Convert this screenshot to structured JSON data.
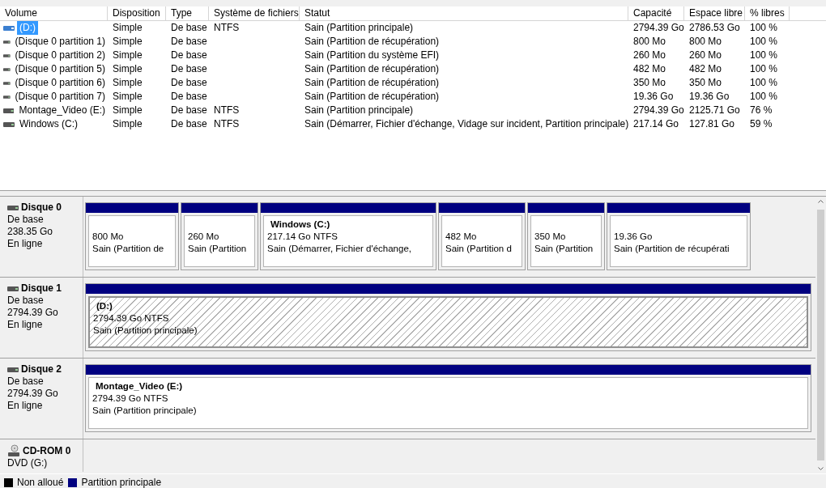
{
  "volume_list": {
    "columns": [
      "Volume",
      "Disposition",
      "Type",
      "Système de fichiers",
      "Statut",
      "Capacité",
      "Espace libre",
      "% libres"
    ],
    "rows": [
      {
        "selected": true,
        "cells": [
          "(D:)",
          "Simple",
          "De base",
          "NTFS",
          "Sain (Partition principale)",
          "2794.39 Go",
          "2786.53 Go",
          "100 %"
        ]
      },
      {
        "selected": false,
        "cells": [
          "(Disque 0 partition 1)",
          "Simple",
          "De base",
          "",
          "Sain (Partition de récupération)",
          "800 Mo",
          "800 Mo",
          "100 %"
        ]
      },
      {
        "selected": false,
        "cells": [
          "(Disque 0 partition 2)",
          "Simple",
          "De base",
          "",
          "Sain (Partition du système EFI)",
          "260 Mo",
          "260 Mo",
          "100 %"
        ]
      },
      {
        "selected": false,
        "cells": [
          "(Disque 0 partition 5)",
          "Simple",
          "De base",
          "",
          "Sain (Partition de récupération)",
          "482 Mo",
          "482 Mo",
          "100 %"
        ]
      },
      {
        "selected": false,
        "cells": [
          "(Disque 0 partition 6)",
          "Simple",
          "De base",
          "",
          "Sain (Partition de récupération)",
          "350 Mo",
          "350 Mo",
          "100 %"
        ]
      },
      {
        "selected": false,
        "cells": [
          "(Disque 0 partition 7)",
          "Simple",
          "De base",
          "",
          "Sain (Partition de récupération)",
          "19.36 Go",
          "19.36 Go",
          "100 %"
        ]
      },
      {
        "selected": false,
        "cells": [
          "Montage_Video (E:)",
          "Simple",
          "De base",
          "NTFS",
          "Sain (Partition principale)",
          "2794.39 Go",
          "2125.71 Go",
          "76 %"
        ]
      },
      {
        "selected": false,
        "cells": [
          "Windows (C:)",
          "Simple",
          "De base",
          "NTFS",
          "Sain (Démarrer, Fichier d'échange, Vidage sur incident, Partition principale)",
          "217.14 Go",
          "127.81 Go",
          "59 %"
        ]
      }
    ]
  },
  "disks": [
    {
      "kind": "disk",
      "name": "Disque 0",
      "lines": [
        "De base",
        "238.35 Go",
        "En ligne"
      ],
      "partitions": [
        {
          "selected": false,
          "size": "800 Mo",
          "status": "Sain (Partition de"
        },
        {
          "selected": false,
          "size": "260 Mo",
          "status": "Sain (Partition"
        },
        {
          "selected": false,
          "name": "Windows  (C:)",
          "size": "217.14 Go NTFS",
          "status": "Sain (Démarrer, Fichier d'échange,"
        },
        {
          "selected": false,
          "size": "482 Mo",
          "status": "Sain (Partition d"
        },
        {
          "selected": false,
          "size": "350 Mo",
          "status": "Sain (Partition"
        },
        {
          "selected": false,
          "size": "19.36 Go",
          "status": "Sain (Partition de récupérati"
        }
      ]
    },
    {
      "kind": "disk",
      "name": "Disque 1",
      "lines": [
        "De base",
        "2794.39 Go",
        "En ligne"
      ],
      "partitions": [
        {
          "selected": true,
          "name": "(D:)",
          "size": "2794.39 Go NTFS",
          "status": "Sain (Partition principale)"
        }
      ]
    },
    {
      "kind": "disk",
      "name": "Disque 2",
      "lines": [
        "De base",
        "2794.39 Go",
        "En ligne"
      ],
      "partitions": [
        {
          "selected": false,
          "name": "Montage_Video  (E:)",
          "size": "2794.39 Go NTFS",
          "status": "Sain (Partition principale)"
        }
      ]
    },
    {
      "kind": "cdrom",
      "name": "CD-ROM 0",
      "lines": [
        "DVD (G:)"
      ]
    }
  ],
  "legend": [
    {
      "label": "Non alloué",
      "color": "#000000"
    },
    {
      "label": "Partition principale",
      "color": "#000080"
    }
  ]
}
